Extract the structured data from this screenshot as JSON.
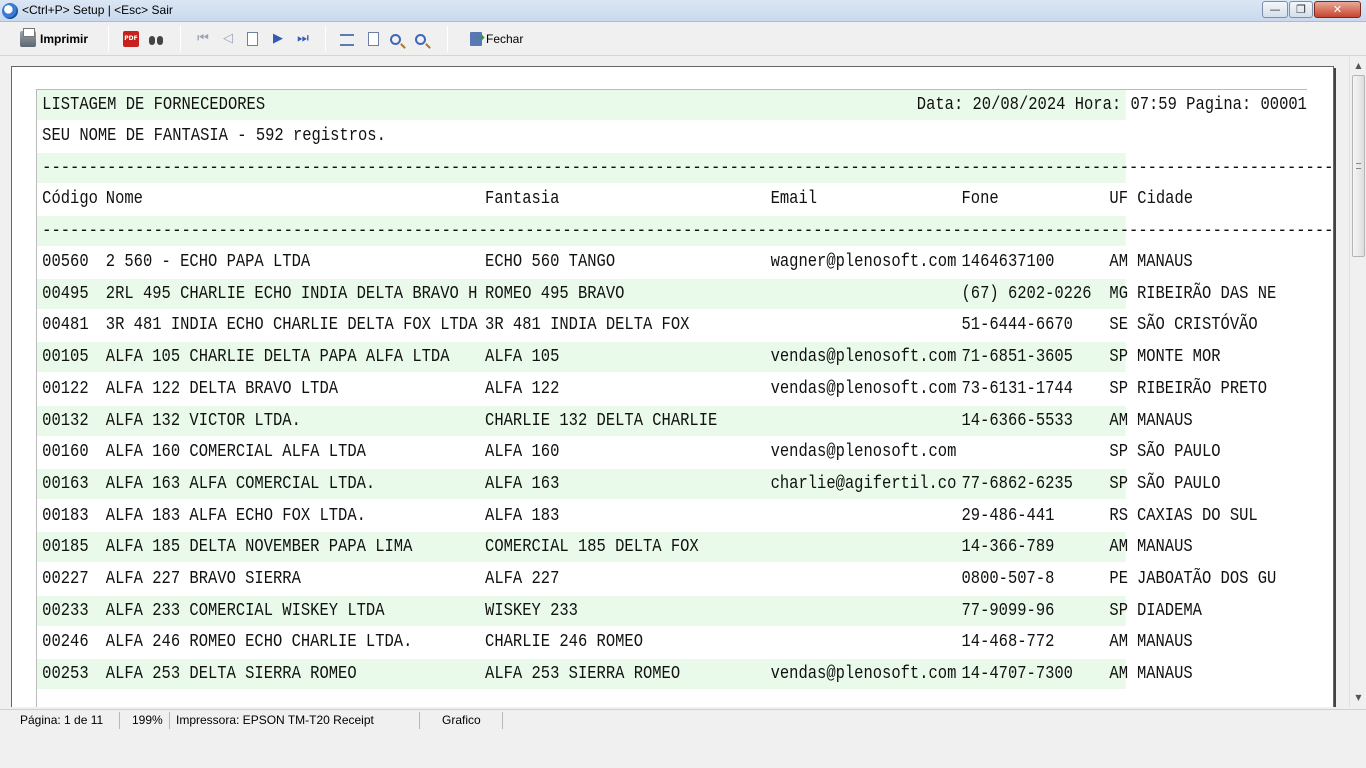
{
  "window": {
    "title": "<Ctrl+P> Setup | <Esc> Sair",
    "minimize": "—",
    "maximize": "❐",
    "close": "✕"
  },
  "toolbar": {
    "print_label": "Imprimir",
    "close_label": "Fechar",
    "pdf_icon_text": "PDF"
  },
  "report": {
    "title": "LISTAGEM DE FORNECEDORES",
    "header_right": "Data: 20/08/2024 Hora: 07:59 Pagina: 00001",
    "subtitle": "SEU NOME DE FANTASIA - 592 registros.",
    "separator": "-----------------------------------------------------------------------------------------------------------------------------------------------",
    "columns": {
      "code": "Código",
      "name": "Nome",
      "fantasy": "Fantasia",
      "email": "Email",
      "phone": "Fone",
      "state_city": "UF Cidade"
    },
    "rows": [
      {
        "code": "00560",
        "name": "2 560 - ECHO PAPA LTDA",
        "fantasy": "ECHO 560 TANGO",
        "email": "wagner@plenosoft.com",
        "phone": "1464637100",
        "uf": "AM",
        "city": "MANAUS"
      },
      {
        "code": "00495",
        "name": "2RL 495 CHARLIE ECHO INDIA DELTA BRAVO H",
        "fantasy": "ROMEO 495 BRAVO",
        "email": "",
        "phone": "(67) 6202-0226",
        "uf": "MG",
        "city": "RIBEIRÃO DAS NE"
      },
      {
        "code": "00481",
        "name": "3R 481 INDIA ECHO CHARLIE DELTA FOX LTDA",
        "fantasy": "3R 481 INDIA DELTA FOX",
        "email": "",
        "phone": "51-6444-6670",
        "uf": "SE",
        "city": "SÃO CRISTÓVÃO"
      },
      {
        "code": "00105",
        "name": "ALFA 105 CHARLIE DELTA PAPA ALFA LTDA",
        "fantasy": "ALFA 105",
        "email": "vendas@plenosoft.com",
        "phone": "71-6851-3605",
        "uf": "SP",
        "city": "MONTE MOR"
      },
      {
        "code": "00122",
        "name": "ALFA 122 DELTA BRAVO LTDA",
        "fantasy": "ALFA 122",
        "email": "vendas@plenosoft.com",
        "phone": "73-6131-1744",
        "uf": "SP",
        "city": "RIBEIRÃO PRETO"
      },
      {
        "code": "00132",
        "name": "ALFA 132 VICTOR LTDA.",
        "fantasy": "CHARLIE 132 DELTA CHARLIE",
        "email": "",
        "phone": "14-6366-5533",
        "uf": "AM",
        "city": "MANAUS"
      },
      {
        "code": "00160",
        "name": "ALFA 160 COMERCIAL ALFA LTDA",
        "fantasy": "ALFA 160",
        "email": "vendas@plenosoft.com",
        "phone": "",
        "uf": "SP",
        "city": "SÃO PAULO"
      },
      {
        "code": "00163",
        "name": "ALFA 163 ALFA COMERCIAL LTDA.",
        "fantasy": "ALFA 163",
        "email": "charlie@agifertil.co",
        "phone": "77-6862-6235",
        "uf": "SP",
        "city": "SÃO PAULO"
      },
      {
        "code": "00183",
        "name": "ALFA 183 ALFA ECHO FOX LTDA.",
        "fantasy": "ALFA 183",
        "email": "",
        "phone": "29-486-441",
        "uf": "RS",
        "city": "CAXIAS DO SUL"
      },
      {
        "code": "00185",
        "name": "ALFA 185 DELTA NOVEMBER PAPA LIMA",
        "fantasy": "COMERCIAL 185 DELTA FOX",
        "email": "",
        "phone": "14-366-789",
        "uf": "AM",
        "city": "MANAUS"
      },
      {
        "code": "00227",
        "name": "ALFA 227 BRAVO SIERRA",
        "fantasy": "ALFA 227",
        "email": "",
        "phone": "0800-507-8",
        "uf": "PE",
        "city": "JABOATÃO DOS GU"
      },
      {
        "code": "00233",
        "name": "ALFA 233 COMERCIAL WISKEY LTDA",
        "fantasy": "WISKEY 233",
        "email": "",
        "phone": "77-9099-96",
        "uf": "SP",
        "city": "DIADEMA"
      },
      {
        "code": "00246",
        "name": "ALFA 246 ROMEO ECHO CHARLIE LTDA.",
        "fantasy": "CHARLIE 246 ROMEO",
        "email": "",
        "phone": "14-468-772",
        "uf": "AM",
        "city": "MANAUS"
      },
      {
        "code": "00253",
        "name": "ALFA 253 DELTA SIERRA ROMEO",
        "fantasy": "ALFA 253 SIERRA ROMEO",
        "email": "vendas@plenosoft.com",
        "phone": "14-4707-7300",
        "uf": "AM",
        "city": "MANAUS"
      }
    ]
  },
  "status": {
    "page": "Página: 1 de 11",
    "zoom": "199%",
    "printer": "Impressora: EPSON TM-T20 Receipt",
    "mode": "Grafico"
  },
  "colors": {
    "band": "#eafaea",
    "titlebar": "#dbe6f4"
  }
}
